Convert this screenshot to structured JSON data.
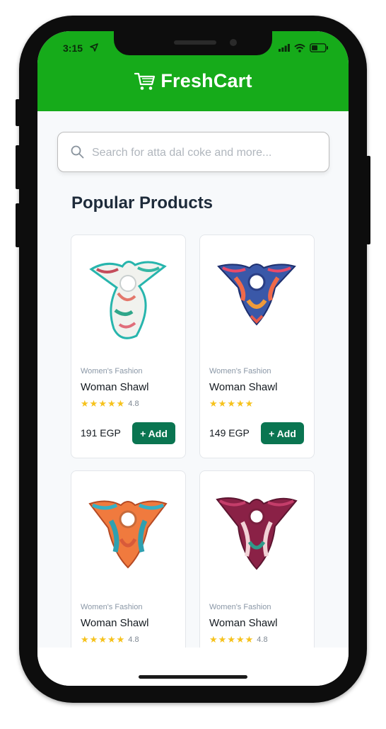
{
  "status": {
    "time": "3:15"
  },
  "header": {
    "brand": "FreshCart"
  },
  "search": {
    "placeholder": "Search for atta dal coke and more..."
  },
  "section": {
    "title": "Popular Products"
  },
  "products": [
    {
      "category": "Women's Fashion",
      "name": "Woman Shawl",
      "rating": "4.8",
      "price": "191 EGP",
      "add_label": "+ Add"
    },
    {
      "category": "Women's Fashion",
      "name": "Woman Shawl",
      "rating": "",
      "price": "149 EGP",
      "add_label": "+ Add"
    },
    {
      "category": "Women's Fashion",
      "name": "Woman Shawl",
      "rating": "4.8",
      "price": "",
      "add_label": ""
    },
    {
      "category": "Women's Fashion",
      "name": "Woman Shawl",
      "rating": "4.8",
      "price": "",
      "add_label": ""
    }
  ],
  "colors": {
    "header": "#16ab1a",
    "add_button": "#0a7551",
    "star": "#f6c21c"
  },
  "icons": [
    "location-arrow-icon",
    "signal-icon",
    "wifi-icon",
    "battery-icon",
    "cart-icon",
    "search-icon",
    "star-icon"
  ]
}
